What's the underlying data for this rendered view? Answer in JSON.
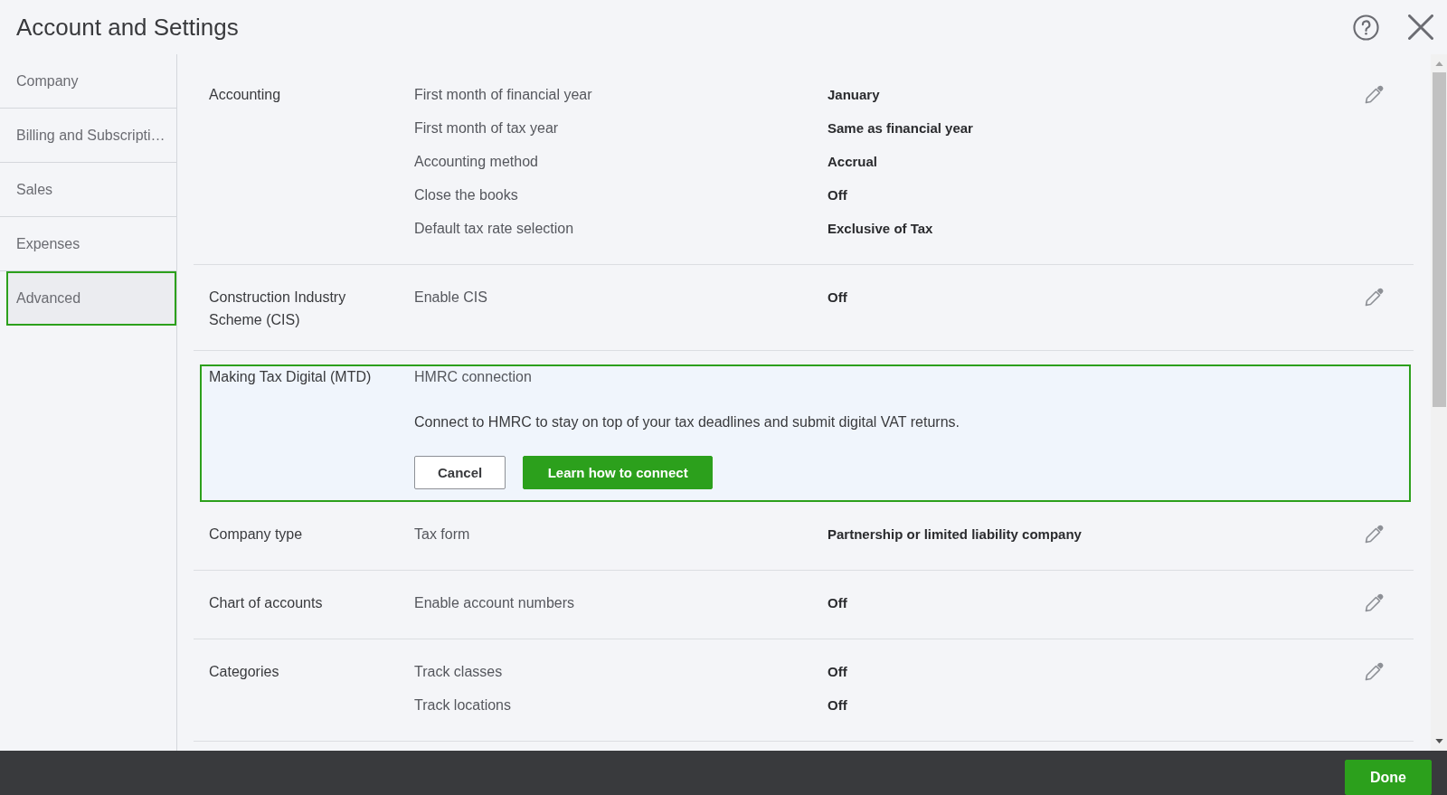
{
  "header": {
    "title": "Account and Settings"
  },
  "sidebar": {
    "items": [
      {
        "label": "Company",
        "selected": false
      },
      {
        "label": "Billing and Subscripti…",
        "selected": false
      },
      {
        "label": "Sales",
        "selected": false
      },
      {
        "label": "Expenses",
        "selected": false
      },
      {
        "label": "Advanced",
        "selected": true
      }
    ]
  },
  "sections": [
    {
      "kind": "settings",
      "title": "Accounting",
      "highlighted": false,
      "rows": [
        {
          "label": "First month of financial year",
          "value": "January"
        },
        {
          "label": "First month of tax year",
          "value": "Same as financial year"
        },
        {
          "label": "Accounting method",
          "value": "Accrual"
        },
        {
          "label": "Close the books",
          "value": "Off"
        },
        {
          "label": "Default tax rate selection",
          "value": "Exclusive of Tax"
        }
      ]
    },
    {
      "kind": "settings",
      "title": "Construction Industry Scheme (CIS)",
      "highlighted": false,
      "rows": [
        {
          "label": "Enable CIS",
          "value": "Off"
        }
      ]
    },
    {
      "kind": "prompt",
      "title": "Making Tax Digital (MTD)",
      "highlighted": true,
      "subtitle": "HMRC connection",
      "message": "Connect to HMRC to stay on top of your tax deadlines and submit digital VAT returns.",
      "buttons": [
        {
          "label": "Cancel",
          "kind": "secondary"
        },
        {
          "label": "Learn how to connect",
          "kind": "primary"
        }
      ]
    },
    {
      "kind": "settings",
      "title": "Company type",
      "highlighted": false,
      "rows": [
        {
          "label": "Tax form",
          "value": "Partnership or limited liability company"
        }
      ]
    },
    {
      "kind": "settings",
      "title": "Chart of accounts",
      "highlighted": false,
      "rows": [
        {
          "label": "Enable account numbers",
          "value": "Off"
        }
      ]
    },
    {
      "kind": "settings",
      "title": "Categories",
      "highlighted": false,
      "rows": [
        {
          "label": "Track classes",
          "value": "Off"
        },
        {
          "label": "Track locations",
          "value": "Off"
        }
      ]
    }
  ],
  "footer": {
    "button": "Done"
  }
}
